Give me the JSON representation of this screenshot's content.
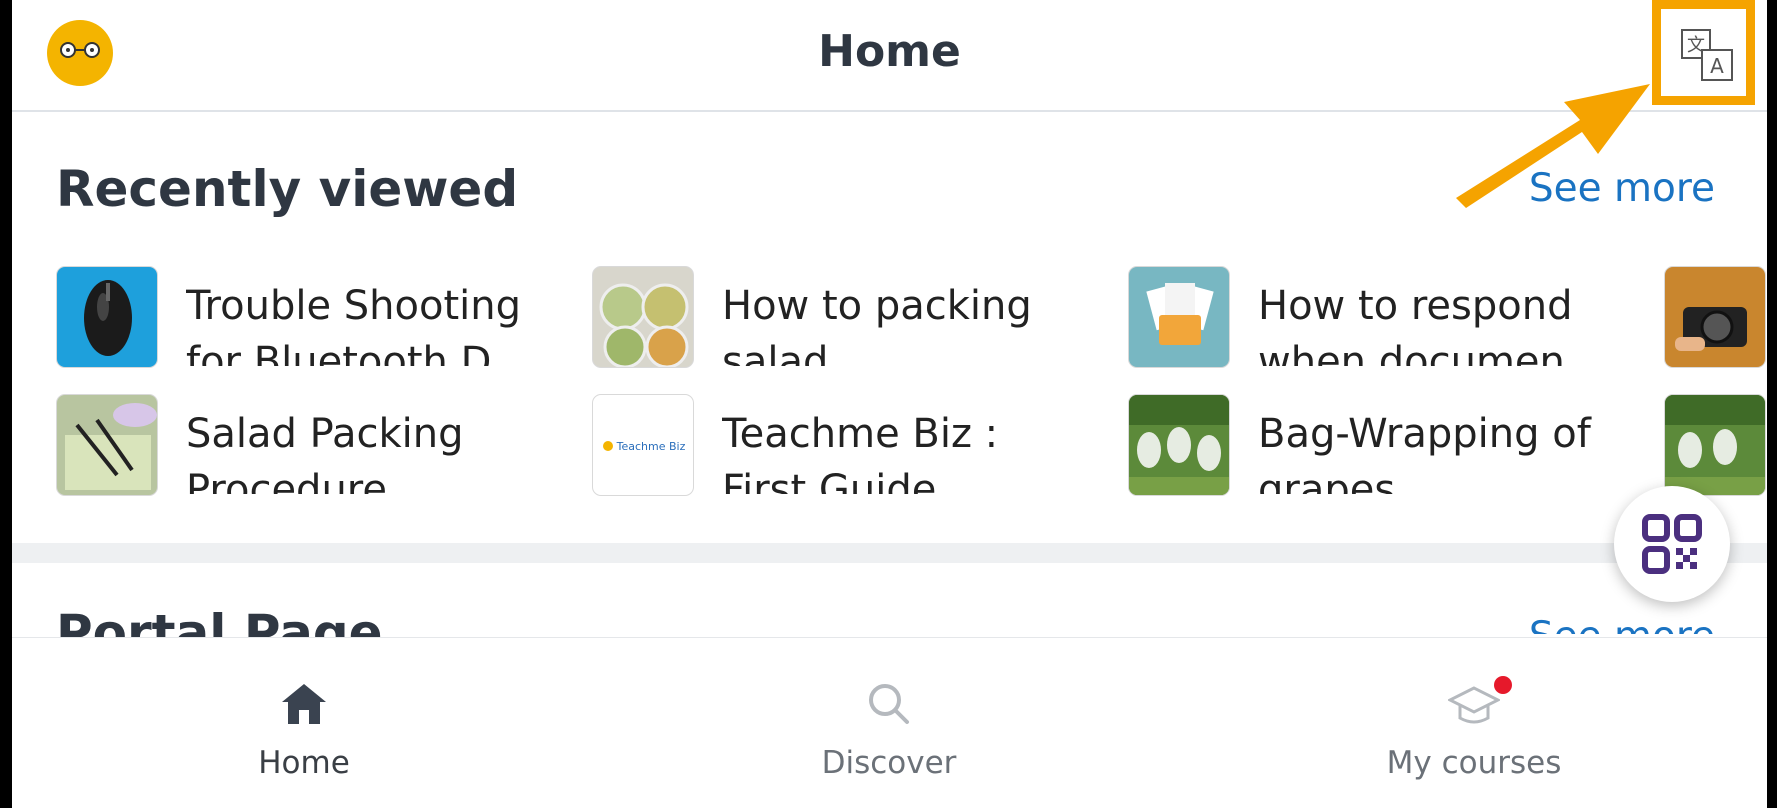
{
  "header": {
    "title": "Home",
    "logo_icon": "owl-logo-icon",
    "translate_icon": "translate-icon"
  },
  "recently_viewed": {
    "title": "Recently viewed",
    "see_more": "See more",
    "items": [
      {
        "title": "Trouble Shooting for Bluetooth D",
        "thumb": "mouse-photo"
      },
      {
        "title": "How to packing salad",
        "thumb": "salad-cups-photo"
      },
      {
        "title": "How to respond when documen",
        "thumb": "documents-folder-photo"
      },
      {
        "title": "",
        "thumb": "camera-photo"
      },
      {
        "title": "Salad Packing Procedure",
        "thumb": "salad-packing-photo"
      },
      {
        "title": "Teachme Biz : First Guide",
        "thumb": "teachme-biz-logo",
        "thumb_text": "Teachme Biz"
      },
      {
        "title": "Bag-Wrapping of grapes",
        "thumb": "grapes-photo"
      },
      {
        "title": "",
        "thumb": "grapes-photo"
      }
    ]
  },
  "portal": {
    "title": "Portal Page",
    "see_more": "See more"
  },
  "qr_button": {
    "icon": "qr-code-icon"
  },
  "nav": {
    "home": "Home",
    "discover": "Discover",
    "my_courses": "My courses"
  },
  "colors": {
    "accent": "#1a73c2",
    "highlight": "#f5a300",
    "qr_purple": "#4b2f7f",
    "badge": "#e6192b"
  }
}
